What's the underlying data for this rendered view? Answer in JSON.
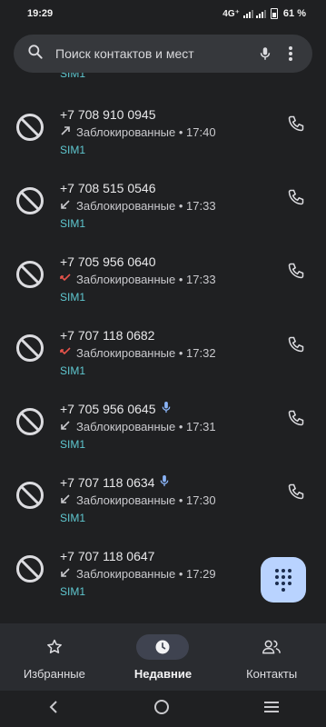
{
  "status_bar": {
    "time": "19:29",
    "network": "4G⁺",
    "battery": "61 %"
  },
  "search": {
    "placeholder": "Поиск контактов и мест"
  },
  "top_partial_sim": "SIM1",
  "calls": [
    {
      "number": "+7 708 910 0945",
      "direction": "outgoing",
      "status": "Заблокированные • 17:40",
      "sim": "SIM1",
      "voicemail": false
    },
    {
      "number": "+7 708 515 0546",
      "direction": "incoming",
      "status": "Заблокированные • 17:33",
      "sim": "SIM1",
      "voicemail": false
    },
    {
      "number": "+7 705 956 0640",
      "direction": "missed",
      "status": "Заблокированные • 17:33",
      "sim": "SIM1",
      "voicemail": false
    },
    {
      "number": "+7 707 118 0682",
      "direction": "missed",
      "status": "Заблокированные • 17:32",
      "sim": "SIM1",
      "voicemail": false
    },
    {
      "number": "+7 705 956 0645",
      "direction": "incoming",
      "status": "Заблокированные • 17:31",
      "sim": "SIM1",
      "voicemail": true
    },
    {
      "number": "+7 707 118 0634",
      "direction": "incoming",
      "status": "Заблокированные • 17:30",
      "sim": "SIM1",
      "voicemail": true
    },
    {
      "number": "+7 707 118 0647",
      "direction": "incoming",
      "status": "Заблокированные • 17:29",
      "sim": "SIM1",
      "voicemail": false
    }
  ],
  "bottom_nav": [
    {
      "label": "Избранные",
      "icon": "star-icon",
      "active": false
    },
    {
      "label": "Недавние",
      "icon": "clock-icon",
      "active": true
    },
    {
      "label": "Контакты",
      "icon": "contacts-icon",
      "active": false
    }
  ],
  "colors": {
    "background": "#1f2022",
    "accent_sim": "#5fc7d0",
    "fab": "#b9d3ff",
    "missed": "#e5534b"
  }
}
